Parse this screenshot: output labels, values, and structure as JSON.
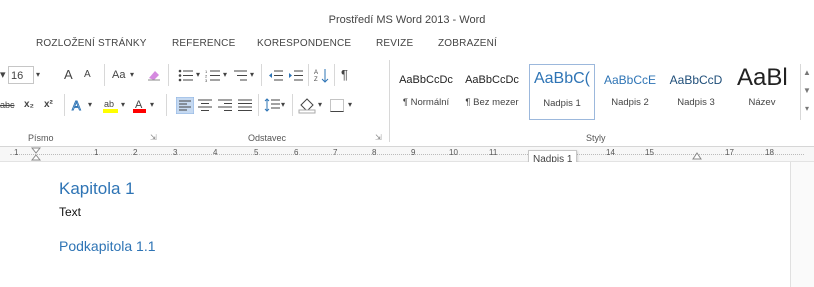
{
  "window": {
    "title": "Prostředí MS Word 2013 - Word"
  },
  "tabs": [
    {
      "label": "ROZLOŽENÍ STRÁNKY"
    },
    {
      "label": "REFERENCE"
    },
    {
      "label": "KORESPONDENCE"
    },
    {
      "label": "REVIZE"
    },
    {
      "label": "ZOBRAZENÍ"
    }
  ],
  "font": {
    "size": "16",
    "grow": "A",
    "shrink": "A",
    "case": "Aa",
    "strike": "abc",
    "sub": "x₂",
    "sup": "x²",
    "color_letter": "A"
  },
  "paragraph": {
    "pilcrow": "¶"
  },
  "groups": {
    "font": "Písmo",
    "paragraph": "Odstavec",
    "styles": "Styly"
  },
  "styles": [
    {
      "sample": "AaBbCcDc",
      "name": "¶ Normální"
    },
    {
      "sample": "AaBbCcDc",
      "name": "¶ Bez mezer"
    },
    {
      "sample": "AaBbC(",
      "name": "Nadpis 1"
    },
    {
      "sample": "AaBbCcE",
      "name": "Nadpis 2"
    },
    {
      "sample": "AaBbCcD",
      "name": "Nadpis 3"
    },
    {
      "sample": "AaBl",
      "name": "Název"
    }
  ],
  "ruler": {
    "marks": [
      "1",
      "1",
      "2",
      "3",
      "4",
      "5",
      "6",
      "7",
      "8",
      "9",
      "10",
      "11",
      "14",
      "15",
      "17",
      "18"
    ]
  },
  "tooltip": {
    "text": "Nadpis 1"
  },
  "document": {
    "heading1": "Kapitola 1",
    "body": "Text",
    "heading2": "Podkapitola 1.1"
  },
  "colors": {
    "heading": "#2e74b5",
    "accent": "#9cb8dc",
    "highlight": "#ffff00",
    "font_color": "#ff0000"
  }
}
